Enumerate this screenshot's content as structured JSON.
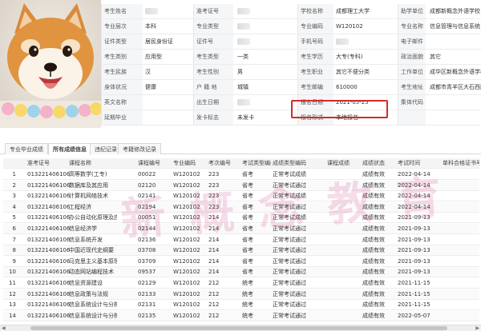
{
  "profile": {
    "rows": [
      [
        {
          "label": "考生姓名",
          "value": "",
          "blur": true
        },
        {
          "label": "准考证号",
          "value": "",
          "blur": true
        },
        {
          "label": "学校名称",
          "value": "成都理工大学"
        },
        {
          "label": "助学单位",
          "value": "成都新概念外语学校"
        }
      ],
      [
        {
          "label": "专业层次",
          "value": "本科"
        },
        {
          "label": "专业类型",
          "value": "",
          "blur": true
        },
        {
          "label": "专业编码",
          "value": "W120102"
        },
        {
          "label": "专业名称",
          "value": "信息管理与信息系统"
        }
      ],
      [
        {
          "label": "证件类型",
          "value": "居民身份证"
        },
        {
          "label": "证件号",
          "value": "",
          "blur": true
        },
        {
          "label": "手机号码",
          "value": "",
          "blur": true
        },
        {
          "label": "电子邮件",
          "value": ""
        }
      ],
      [
        {
          "label": "考生类别",
          "value": "应用型"
        },
        {
          "label": "考生类型",
          "value": "一类"
        },
        {
          "label": "考生学历",
          "value": "大专(专科)"
        },
        {
          "label": "政治面貌",
          "value": "其它"
        }
      ],
      [
        {
          "label": "考生民族",
          "value": "汉"
        },
        {
          "label": "考生性别",
          "value": "男"
        },
        {
          "label": "考生职业",
          "value": "其它不便分类"
        },
        {
          "label": "工作单位",
          "value": "成华区新概念外语学校"
        }
      ],
      [
        {
          "label": "身体状况",
          "value": "健康"
        },
        {
          "label": "户 籍 地",
          "value": "城镇"
        },
        {
          "label": "考生邮编",
          "value": "610000"
        },
        {
          "label": "考生地址",
          "value": "成都市青羊区大石西路12号"
        }
      ],
      [
        {
          "label": "英文名称",
          "value": ""
        },
        {
          "label": "出生日期",
          "value": "",
          "blur": true
        },
        {
          "label": "报名日期",
          "value": "2021-05-25"
        },
        {
          "label": "集体代码",
          "value": ""
        }
      ],
      [
        {
          "label": "延期毕业",
          "value": ""
        },
        {
          "label": "发卡标志",
          "value": "未发卡"
        },
        {
          "label": "报名形式",
          "value": "本地报名"
        },
        {
          "label": "",
          "value": ""
        }
      ]
    ]
  },
  "tabs": [
    {
      "label": "专业毕业成绩",
      "active": false
    },
    {
      "label": "所有成绩信息",
      "active": true
    },
    {
      "label": "违纪记录",
      "active": false
    },
    {
      "label": "考籍修改记录",
      "active": false
    }
  ],
  "table": {
    "columns": [
      "",
      "准考证号",
      "课程名称",
      "课程编号",
      "专业编码",
      "考次编号",
      "考试类型编码",
      "成绩类型编码",
      "课程成绩",
      "成绩状态",
      "考试时间",
      "单科合格证书号"
    ],
    "rows": [
      [
        "1",
        "013221406106",
        "高等数学(工专)",
        "00022",
        "W120102",
        "223",
        "省考",
        "正常考试成绩",
        "",
        "成绩有效",
        "2022-04-14",
        ""
      ],
      [
        "2",
        "013221406106",
        "数据库及其应用",
        "02120",
        "W120102",
        "223",
        "省考",
        "正常考试通过",
        "",
        "成绩有效",
        "2022-04-14",
        ""
      ],
      [
        "3",
        "013221406106",
        "计算机网络技术",
        "02141",
        "W120102",
        "223",
        "省考",
        "正常考试成绩",
        "",
        "成绩有效",
        "2022-04-14",
        ""
      ],
      [
        "4",
        "013221406106",
        "工程经济",
        "02194",
        "W120102",
        "223",
        "省考",
        "正常考试通过",
        "",
        "成绩有效",
        "2022-04-14",
        ""
      ],
      [
        "5",
        "013221406106",
        "办公自动化原理及应用",
        "00051",
        "W120102",
        "214",
        "省考",
        "正常考试成绩",
        "",
        "成绩有效",
        "2021-09-13",
        ""
      ],
      [
        "6",
        "013221406106",
        "信息经济学",
        "02144",
        "W120102",
        "214",
        "省考",
        "正常考试通过",
        "",
        "成绩有效",
        "2021-09-13",
        ""
      ],
      [
        "7",
        "013221406106",
        "信息系统开发",
        "02136",
        "W120102",
        "214",
        "省考",
        "正常考试通过",
        "",
        "成绩有效",
        "2021-09-13",
        ""
      ],
      [
        "8",
        "013221406106",
        "中国近现代史纲要",
        "03708",
        "W120102",
        "214",
        "省考",
        "正常考试通过",
        "",
        "成绩有效",
        "2021-09-13",
        ""
      ],
      [
        "9",
        "013221406106",
        "马克思主义基本原理概论",
        "03709",
        "W120102",
        "214",
        "省考",
        "正常考试通过",
        "",
        "成绩有效",
        "2021-09-13",
        ""
      ],
      [
        "10",
        "013221406106",
        "动态网站编程技术",
        "09537",
        "W120102",
        "214",
        "省考",
        "正常考试通过",
        "",
        "成绩有效",
        "2021-09-13",
        ""
      ],
      [
        "11",
        "013221406106",
        "信息资源建设",
        "02129",
        "W120102",
        "212",
        "统考",
        "正常考试通过",
        "",
        "成绩有效",
        "2021-11-15",
        ""
      ],
      [
        "12",
        "013221406106",
        "信息政策与法规",
        "02133",
        "W120102",
        "212",
        "统考",
        "正常考试通过",
        "",
        "成绩有效",
        "2021-11-15",
        ""
      ],
      [
        "13",
        "013221406106",
        "信息系统设计与分析",
        "02131",
        "W120102",
        "212",
        "统考",
        "正常考试通过",
        "",
        "成绩有效",
        "2021-11-15",
        ""
      ],
      [
        "14",
        "013221406106",
        "信息系统设计与分析（实践）",
        "02135",
        "W120102",
        "212",
        "统考",
        "正常考试通过",
        "",
        "成绩有效",
        "2022-05-07",
        ""
      ]
    ]
  },
  "watermark": "新概念教育"
}
